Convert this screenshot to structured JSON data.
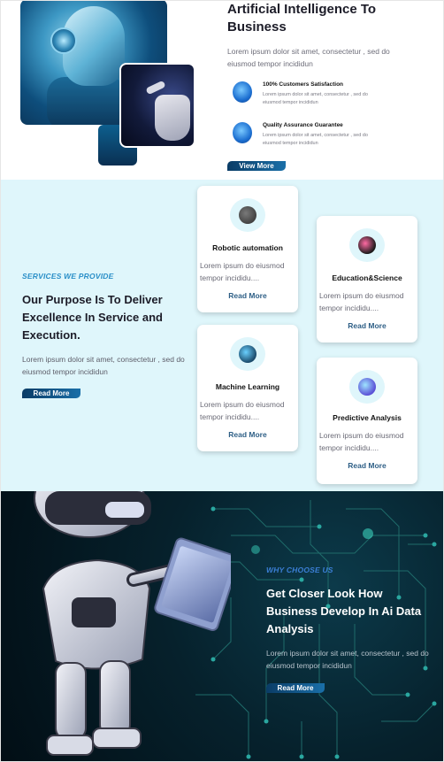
{
  "hero": {
    "title": "Artificial Intelligence To Business",
    "description": "Lorem ipsum dolor sit amet, consectetur , sed do eiusmod tempor incididun",
    "features": [
      {
        "title": "100% Customers Satisfaction",
        "text": "Lorem ipsum dolor sit amet, consectetur , sed do eiusmod tempor incididun",
        "icon": "robot-face-icon"
      },
      {
        "title": "Quality Assurance Guarantee",
        "text": "Lorem ipsum dolor sit amet, consectetur , sed do eiusmod tempor incididun",
        "icon": "robot-bust-icon"
      }
    ],
    "button_label": "View More"
  },
  "services": {
    "tag": "SERVICES WE PROVIDE",
    "title": "Our Purpose Is To Deliver Excellence In Service and Execution.",
    "description": "Lorem ipsum dolor sit amet, consectetur , sed do eiusmod tempor incididun",
    "button_label": "Read More",
    "cards": [
      {
        "title": "Robotic automation",
        "text": "Lorem ipsum do eiusmod tempor incididu....",
        "link": "Read More",
        "icon": "brain-icon"
      },
      {
        "title": "Education&Science",
        "text": "Lorem ipsum do eiusmod tempor incididu....",
        "link": "Read More",
        "icon": "robot-arm-icon"
      },
      {
        "title": "Machine Learning",
        "text": "Lorem ipsum do eiusmod tempor incididu....",
        "link": "Read More",
        "icon": "robot-head-icon"
      },
      {
        "title": "Predictive Analysis",
        "text": "Lorem ipsum do eiusmod tempor incididu....",
        "link": "Read More",
        "icon": "gear-hand-icon"
      }
    ]
  },
  "why": {
    "tag": "WHY CHOOSE US",
    "title": "Get Closer Look How Business Develop In Ai Data Analysis",
    "description": "Lorem ipsum dolor sit amet, consectetur , sed do eiusmod tempor incididun",
    "button_label": "Read More"
  },
  "colors": {
    "accent": "#2a8fc8",
    "button": "#0a3c66",
    "services_bg": "#dff6fb",
    "dark_bg": "#06212c"
  }
}
